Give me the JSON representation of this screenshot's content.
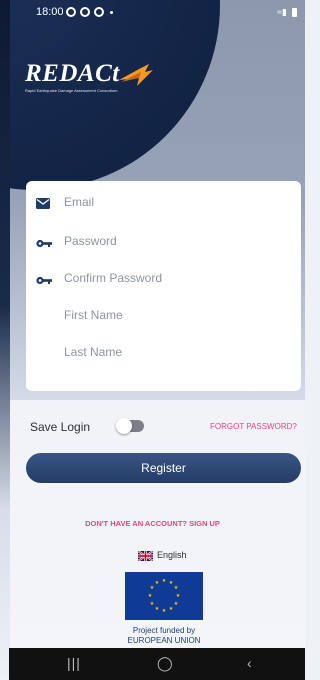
{
  "status_bar": {
    "time": "18:00"
  },
  "logo": {
    "word": "REDACt",
    "tagline": "Rapid Earthquake Damage Assessment Consortium"
  },
  "form": {
    "email_placeholder": "Email",
    "password_placeholder": "Password",
    "confirm_password_placeholder": "Confirm Password",
    "first_name_placeholder": "First Name",
    "last_name_placeholder": "Last Name"
  },
  "options": {
    "save_login_label": "Save Login",
    "save_login_enabled": false,
    "forgot_password_label": "FORGOT PASSWORD?"
  },
  "register_button": "Register",
  "signup_link": "DON'T HAVE AN ACCOUNT? SIGN UP",
  "language": {
    "label": "English",
    "flag_icon": "uk-flag-icon"
  },
  "eu_funding": {
    "line1": "Project funded by",
    "line2": "EUROPEAN UNION"
  },
  "colors": {
    "navy": "#142649",
    "accent_pink": "#e0477d",
    "button_blue": "#2e4a77",
    "logo_orange": "#f29a21"
  }
}
